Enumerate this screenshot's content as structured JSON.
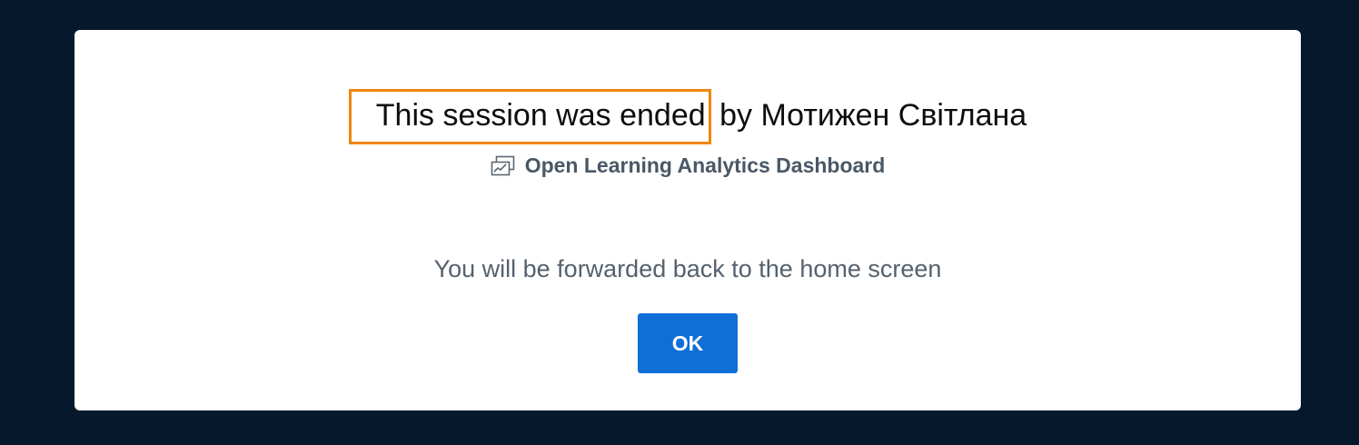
{
  "dialog": {
    "title_highlighted": "This session was ended",
    "title_rest": " by Мотижен Світлана",
    "session_name": "Open Learning Analytics Dashboard",
    "session_icon": "presentation-icon",
    "message": "You will be forwarded back to the home screen",
    "ok_label": "OK"
  },
  "colors": {
    "backdrop": "#06182b",
    "highlight_border": "#f0860f",
    "button": "#0f6fd7"
  }
}
